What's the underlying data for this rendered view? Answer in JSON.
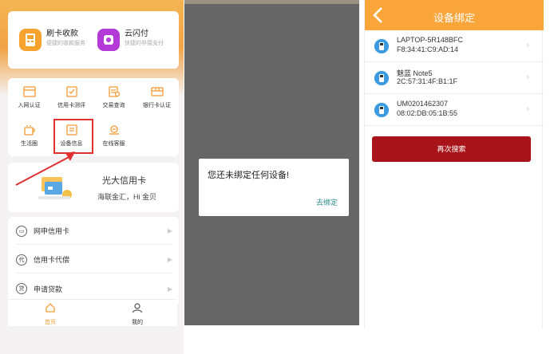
{
  "panel1": {
    "quick_actions": [
      {
        "title": "刷卡收款",
        "subtitle": "便捷的收款服务",
        "icon": "card-reader-icon",
        "color": "#f6a22e"
      },
      {
        "title": "云闪付",
        "subtitle": "快捷的非接支付",
        "icon": "cloud-pay-icon",
        "color": "#b43ad8"
      }
    ],
    "grid": [
      {
        "label": "入网认证",
        "icon": "certification-icon"
      },
      {
        "label": "信用卡测评",
        "icon": "credit-evaluation-icon"
      },
      {
        "label": "交易查询",
        "icon": "transaction-query-icon"
      },
      {
        "label": "银行卡认证",
        "icon": "bank-card-auth-icon"
      },
      {
        "label": "生活圈",
        "icon": "life-circle-icon"
      },
      {
        "label": "设备信息",
        "icon": "device-info-icon"
      },
      {
        "label": "在线客服",
        "icon": "customer-service-icon"
      }
    ],
    "banner": {
      "title": "光大信用卡",
      "subtitle": "海联金汇，Hi 金贝"
    },
    "list": [
      {
        "label": "网申信用卡",
        "icon": "credit-card-apply-icon",
        "glyph": "▭"
      },
      {
        "label": "信用卡代偿",
        "icon": "repayment-icon",
        "glyph": "代"
      },
      {
        "label": "申请贷款",
        "icon": "loan-icon",
        "glyph": "贷"
      }
    ],
    "tabs": [
      {
        "label": "首页",
        "icon": "home-icon",
        "active": true
      },
      {
        "label": "我的",
        "icon": "profile-icon",
        "active": false
      }
    ],
    "accent": "#f4a13a"
  },
  "panel2": {
    "dialog_message": "您还未绑定任何设备!",
    "dialog_button": "去绑定",
    "button_color": "#2c8c8c"
  },
  "panel3": {
    "title": "设备绑定",
    "devices": [
      {
        "name": "LAPTOP-5R148BFC",
        "mac": "F8:34:41:C9:AD:14"
      },
      {
        "name": "魅蓝 Note5",
        "mac": "2C:57:31:4F:B1:1F"
      },
      {
        "name": "UM0201462307",
        "mac": "08:02:DB:05:1B:55"
      }
    ],
    "search_again": "再次搜索",
    "header_color": "#f9a53a",
    "button_color": "#a9141a"
  }
}
